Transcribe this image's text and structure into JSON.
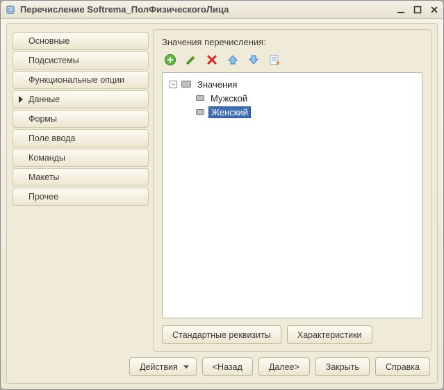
{
  "window": {
    "title": "Перечисление Softrema_ПолФизическогоЛица"
  },
  "sidebar": {
    "items": [
      {
        "label": "Основные"
      },
      {
        "label": "Подсистемы"
      },
      {
        "label": "Функциональные опции"
      },
      {
        "label": "Данные"
      },
      {
        "label": "Формы"
      },
      {
        "label": "Поле ввода"
      },
      {
        "label": "Команды"
      },
      {
        "label": "Макеты"
      },
      {
        "label": "Прочее"
      }
    ],
    "active_index": 3
  },
  "panel": {
    "label": "Значения перечисления:",
    "tree": {
      "root": "Значения",
      "children": [
        {
          "label": "Мужской"
        },
        {
          "label": "Женский"
        }
      ],
      "selected_index": 1
    },
    "buttons": {
      "standard_requisites": "Стандартные реквизиты",
      "characteristics": "Характеристики"
    }
  },
  "footer": {
    "actions": "Действия",
    "back": "<Назад",
    "next": "Далее>",
    "close": "Закрыть",
    "help": "Справка"
  }
}
